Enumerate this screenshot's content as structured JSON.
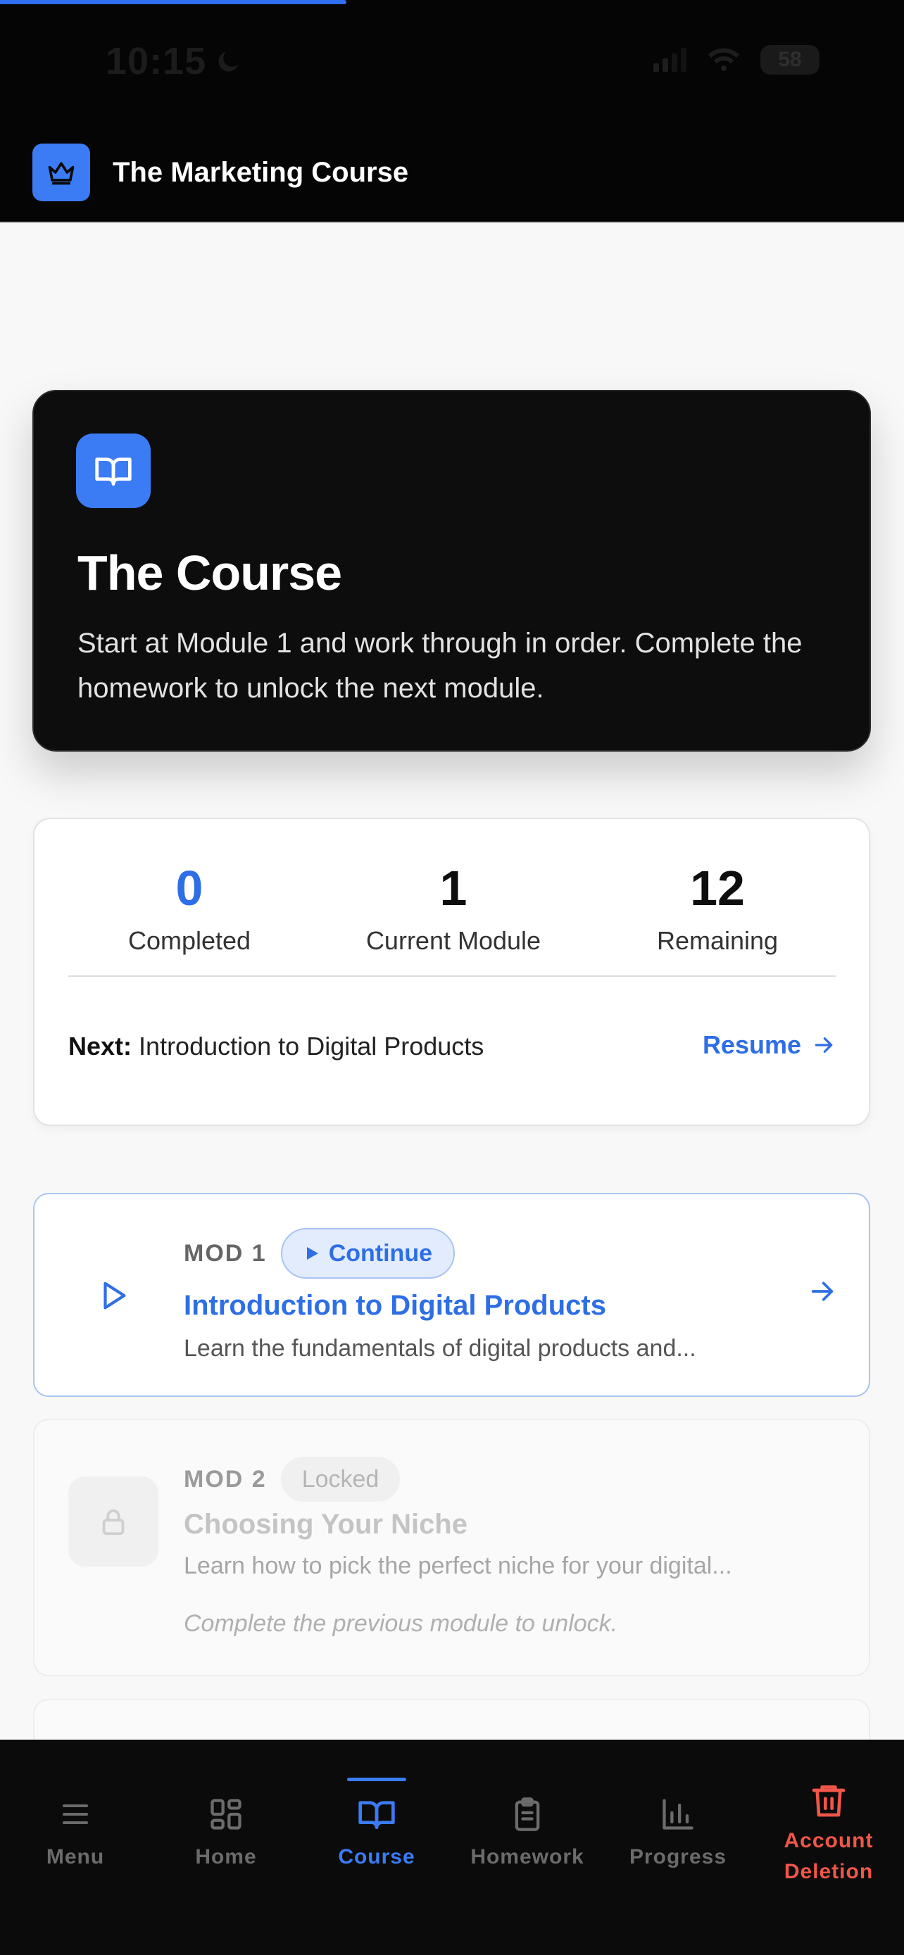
{
  "status_bar": {
    "time": "10:15",
    "battery": "58"
  },
  "header": {
    "title": "The Marketing Course"
  },
  "hero": {
    "title": "The Course",
    "description": "Start at Module 1 and work through in order. Complete the homework to unlock the next module."
  },
  "stats": {
    "completed": {
      "value": "0",
      "label": "Completed"
    },
    "current": {
      "value": "1",
      "label": "Current Module"
    },
    "remaining": {
      "value": "12",
      "label": "Remaining"
    },
    "next_label": "Next:",
    "next_value": "Introduction to Digital Products",
    "resume_label": "Resume"
  },
  "modules": [
    {
      "tag": "MOD 1",
      "status": "Continue",
      "title": "Introduction to Digital Products",
      "description": "Learn the fundamentals of digital products and..."
    },
    {
      "tag": "MOD 2",
      "status": "Locked",
      "title": "Choosing Your Niche",
      "description": "Learn how to pick the perfect niche for your digital...",
      "note": "Complete the previous module to unlock."
    }
  ],
  "tabs": [
    {
      "label": "Menu",
      "icon": "menu-icon"
    },
    {
      "label": "Home",
      "icon": "grid-icon"
    },
    {
      "label": "Course",
      "icon": "book-icon"
    },
    {
      "label": "Homework",
      "icon": "clipboard-icon"
    },
    {
      "label": "Progress",
      "icon": "bar-chart-icon"
    },
    {
      "label": "Account Deletion",
      "icon": "trash-icon"
    }
  ],
  "colors": {
    "accent": "#2e6ee6",
    "danger": "#f0564a",
    "dark": "#0d0d0d"
  }
}
